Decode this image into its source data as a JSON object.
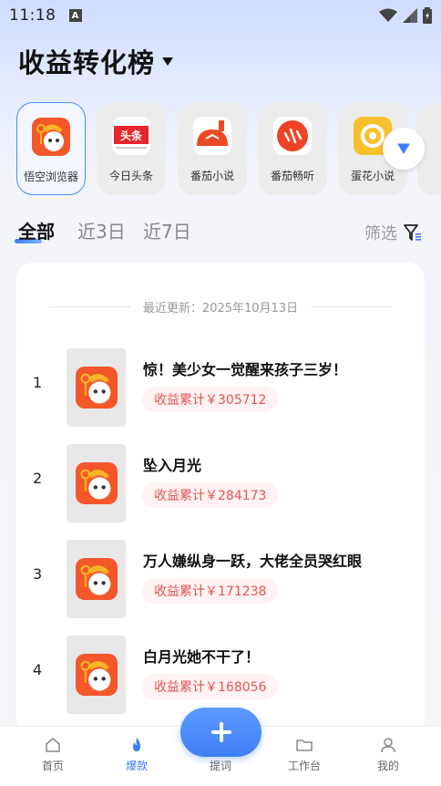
{
  "status_bar": {
    "time": "11:18",
    "notification_glyph": "A"
  },
  "header": {
    "title": "收益转化榜"
  },
  "apps": [
    {
      "label": "悟空浏览器",
      "icon": "wukong-browser-icon",
      "active": true
    },
    {
      "label": "今日头条",
      "icon": "toutiao-icon",
      "icon_text": "头条"
    },
    {
      "label": "番茄小说",
      "icon": "fanqie-novel-icon"
    },
    {
      "label": "番茄畅听",
      "icon": "fanqie-listen-icon"
    },
    {
      "label": "蛋花小说",
      "icon": "danhua-novel-icon"
    }
  ],
  "tabs": [
    {
      "label": "全部",
      "active": true
    },
    {
      "label": "近3日"
    },
    {
      "label": "近7日"
    }
  ],
  "filter": {
    "label": "筛选"
  },
  "list": {
    "update_text": "最近更新：2025年10月13日",
    "items": [
      {
        "rank": "1",
        "title": "惊！美少女一觉醒来孩子三岁！",
        "badge": "收益累计￥305712"
      },
      {
        "rank": "2",
        "title": "坠入月光",
        "badge": "收益累计￥284173"
      },
      {
        "rank": "3",
        "title": "万人嫌纵身一跃，大佬全员哭红眼",
        "badge": "收益累计￥171238"
      },
      {
        "rank": "4",
        "title": "白月光她不干了！",
        "badge": "收益累计￥168056"
      }
    ]
  },
  "bottom_nav": [
    {
      "label": "首页",
      "icon": "home-icon"
    },
    {
      "label": "爆款",
      "icon": "flame-icon",
      "active": true
    },
    {
      "label": "提词",
      "icon": "plus-icon"
    },
    {
      "label": "工作台",
      "icon": "folder-icon"
    },
    {
      "label": "我的",
      "icon": "user-icon"
    }
  ],
  "colors": {
    "accent": "#3c7cf6",
    "badge_text": "#e05454",
    "badge_bg": "#fff2f2"
  }
}
